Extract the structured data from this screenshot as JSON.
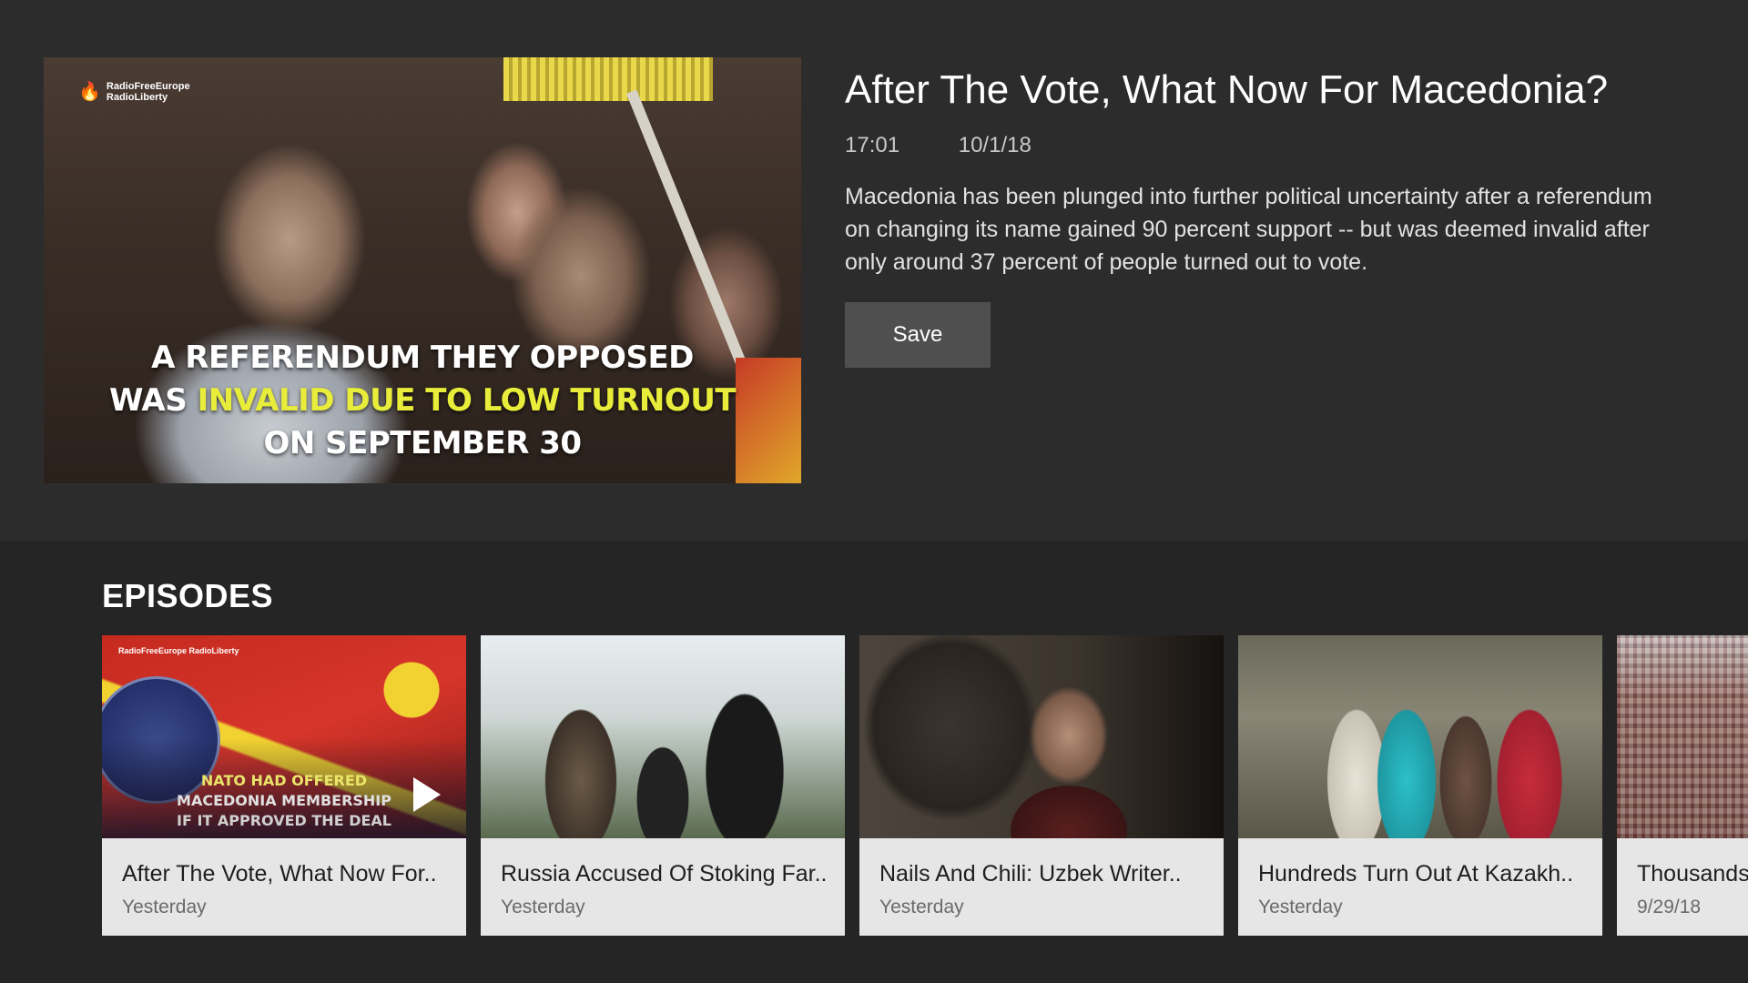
{
  "hero": {
    "thumbnail": {
      "logo_line1": "RadioFreeEurope",
      "logo_line2": "RadioLiberty",
      "caption_line1": "A REFERENDUM THEY OPPOSED",
      "caption_line2_white": "WAS ",
      "caption_line2_yellow": "INVALID DUE TO LOW TURNOUT",
      "caption_line3": "ON SEPTEMBER 30"
    },
    "title": "After The Vote, What Now For Macedonia?",
    "duration": "17:01",
    "date": "10/1/18",
    "description": "Macedonia has been plunged into further political uncertainty after a referendum on changing its name gained 90 percent support -- but was deemed invalid after only around 37 percent of people turned out to vote.",
    "save_label": "Save"
  },
  "episodes": {
    "heading": "EPISODES",
    "items": [
      {
        "title": "After The Vote, What Now For..",
        "date": "Yesterday",
        "overlay_line1": "NATO HAD OFFERED",
        "overlay_line2": "MACEDONIA MEMBERSHIP",
        "overlay_line3": "IF IT APPROVED THE DEAL",
        "logo": "RadioFreeEurope RadioLiberty"
      },
      {
        "title": "Russia Accused Of Stoking Far..",
        "date": "Yesterday"
      },
      {
        "title": "Nails And Chili: Uzbek Writer..",
        "date": "Yesterday"
      },
      {
        "title": "Hundreds Turn Out At Kazakh..",
        "date": "Yesterday"
      },
      {
        "title": "Thousands",
        "date": "9/29/18"
      }
    ]
  },
  "colors": {
    "background": "#2c2c2c",
    "episodes_background": "#252525",
    "card_background": "#e6e6e6",
    "button_background": "#4f4f4f",
    "caption_highlight": "#e8ec3a"
  },
  "icons": [
    "play-icon",
    "torch-logo-icon"
  ]
}
